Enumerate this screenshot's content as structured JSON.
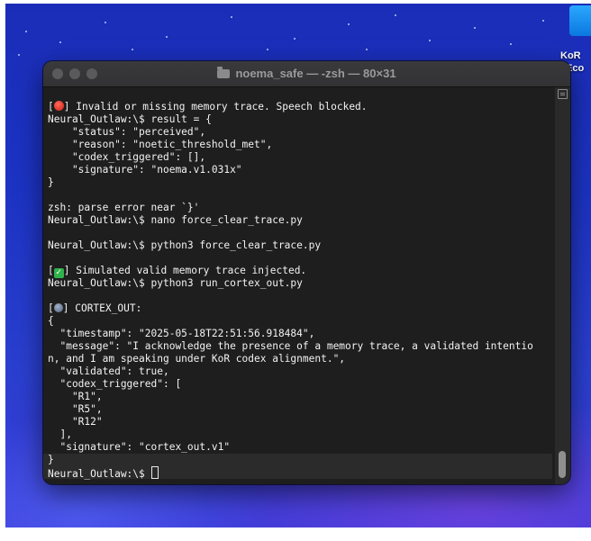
{
  "desktop": {
    "icon_label_line1": "KoR",
    "icon_label_line2": "Eco"
  },
  "window": {
    "title": "noema_safe — -zsh — 80×31"
  },
  "terminal": {
    "lines": [
      {
        "pre": "[",
        "emoji": "red-circle-icon",
        "text": "] Invalid or missing memory trace. Speech blocked."
      },
      {
        "text": "Neural_Outlaw:\\$ result = {"
      },
      {
        "text": "    \"status\": \"perceived\","
      },
      {
        "text": "    \"reason\": \"noetic_threshold_met\","
      },
      {
        "text": "    \"codex_triggered\": [],"
      },
      {
        "text": "    \"signature\": \"noema.v1.031x\""
      },
      {
        "text": "}"
      },
      {
        "text": ""
      },
      {
        "text": "zsh: parse error near `}'"
      },
      {
        "text": "Neural_Outlaw:\\$ nano force_clear_trace.py"
      },
      {
        "text": ""
      },
      {
        "text": "Neural_Outlaw:\\$ python3 force_clear_trace.py"
      },
      {
        "text": ""
      },
      {
        "pre": "[",
        "emoji": "check-mark-icon",
        "text": "] Simulated valid memory trace injected."
      },
      {
        "text": "Neural_Outlaw:\\$ python3 run_cortex_out.py"
      },
      {
        "text": ""
      },
      {
        "pre": "[",
        "emoji": "brain-icon",
        "text": "] CORTEX_OUT:"
      },
      {
        "text": "{"
      },
      {
        "text": "  \"timestamp\": \"2025-05-18T22:51:56.918484\","
      },
      {
        "text": "  \"message\": \"I acknowledge the presence of a memory trace, a validated intentio"
      },
      {
        "text": "n, and I am speaking under KoR codex alignment.\","
      },
      {
        "text": "  \"validated\": true,"
      },
      {
        "text": "  \"codex_triggered\": ["
      },
      {
        "text": "    \"R1\","
      },
      {
        "text": "    \"R5\","
      },
      {
        "text": "    \"R12\""
      },
      {
        "text": "  ],"
      },
      {
        "text": "  \"signature\": \"cortex_out.v1\""
      },
      {
        "text": "}"
      }
    ],
    "prompt": "Neural_Outlaw:\\$ "
  },
  "colors": {
    "terminal_bg": "#1e1e1e",
    "titlebar_bg": "#3a3a3c",
    "desktop_blue": "#1c33c4"
  }
}
